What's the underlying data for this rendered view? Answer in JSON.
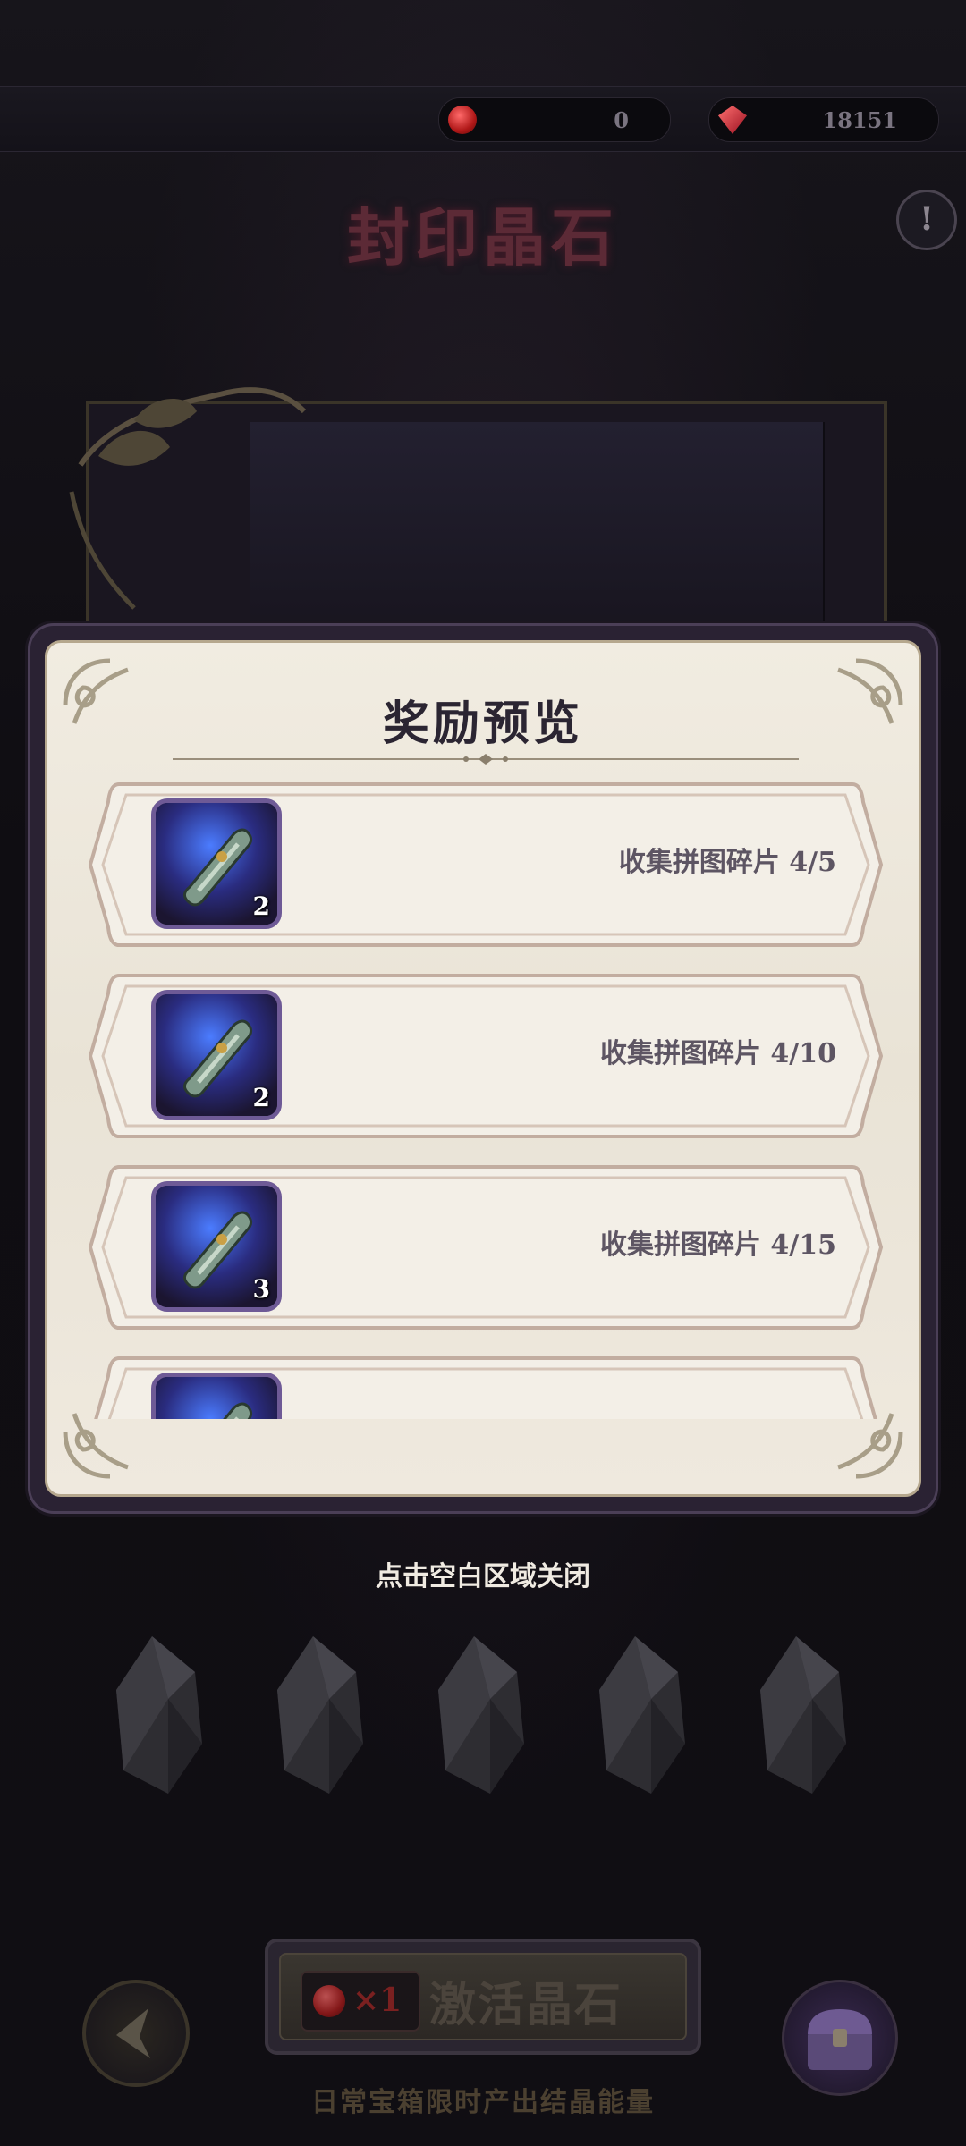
{
  "topbar": {
    "currency_left": {
      "icon": "red-gem-icon",
      "value": "0"
    },
    "currency_right": {
      "icon": "red-crystal-icon",
      "value": "18151"
    }
  },
  "page": {
    "title": "封印晶石",
    "info_icon": "exclamation-icon",
    "info_glyph": "!"
  },
  "modal": {
    "title": "奖励预览",
    "rewards": [
      {
        "icon": "scroll-item-icon",
        "count": "2",
        "condition": "收集拼图碎片 4/5"
      },
      {
        "icon": "scroll-item-icon",
        "count": "2",
        "condition": "收集拼图碎片 4/10"
      },
      {
        "icon": "scroll-item-icon",
        "count": "3",
        "condition": "收集拼图碎片 4/15"
      },
      {
        "icon": "scroll-item-icon",
        "count": "",
        "condition": ""
      }
    ]
  },
  "close_hint": "点击空白区域关闭",
  "crystals": [
    "crystal-icon",
    "crystal-icon",
    "crystal-icon",
    "crystal-icon",
    "crystal-icon"
  ],
  "bottom": {
    "activate_cost": "×1",
    "activate_label": "激活晶石",
    "back_icon": "back-arrow-icon",
    "chest_icon": "treasure-chest-icon",
    "daily_note": "日常宝箱限时产出结晶能量"
  },
  "colors": {
    "background": "#121016",
    "modal_paper": "#efe9de",
    "modal_frame": "#4b3f57",
    "item_frame": "#6e5a96"
  }
}
